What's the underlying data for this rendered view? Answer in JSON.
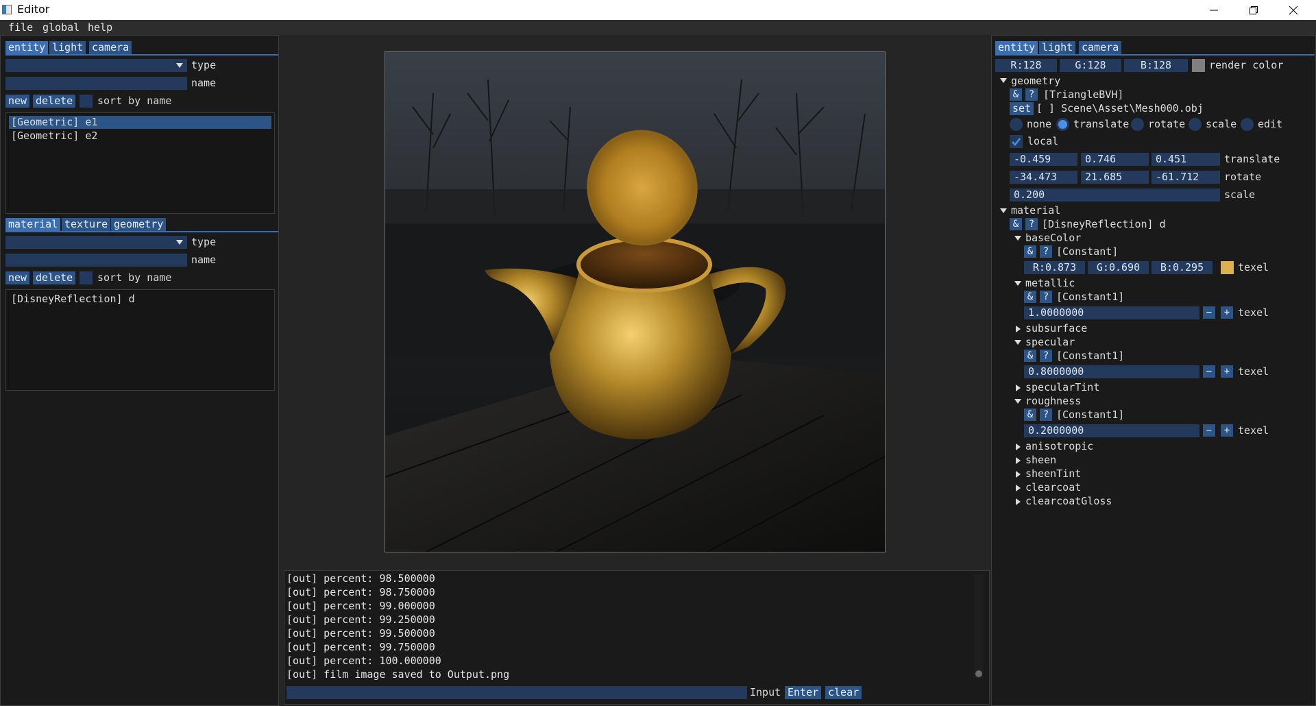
{
  "window": {
    "title": "Editor"
  },
  "menu": [
    "file",
    "global",
    "help"
  ],
  "left": {
    "tabs": [
      "entity",
      "light",
      "camera"
    ],
    "type_label": "type",
    "name_label": "name",
    "new_label": "new",
    "delete_label": "delete",
    "sort_label": "sort by name",
    "entities": [
      "[Geometric] e1",
      "[Geometric] e2"
    ],
    "sub_tabs": [
      "material",
      "texture",
      "geometry"
    ],
    "type_label2": "type",
    "name_label2": "name",
    "new_label2": "new",
    "delete_label2": "delete",
    "sort_label2": "sort by name",
    "materials": [
      "[DisneyReflection] d"
    ]
  },
  "console": {
    "lines": [
      "[out] percent: 98.500000",
      "[out] percent: 98.750000",
      "[out] percent: 99.000000",
      "[out] percent: 99.250000",
      "[out] percent: 99.500000",
      "[out] percent: 99.750000",
      "[out] percent: 100.000000",
      "[out] film image saved to Output.png"
    ],
    "input_label": "Input",
    "enter_label": "Enter",
    "clear_label": "clear"
  },
  "right": {
    "tabs": [
      "entity",
      "light",
      "camera"
    ],
    "render_color": {
      "r": "R:128",
      "g": "G:128",
      "b": "B:128",
      "label": "render color",
      "swatch": "#808080"
    },
    "geometry": {
      "header": "geometry",
      "amp": "&",
      "q": "?",
      "type": "[TriangleBVH]",
      "set_label": "set",
      "path": "[ ] Scene\\Asset\\Mesh000.obj",
      "modes": [
        "none",
        "translate",
        "rotate",
        "scale",
        "edit"
      ],
      "selected_mode": "translate",
      "local_label": "local",
      "translate": [
        "-0.459",
        "0.746",
        "0.451"
      ],
      "translate_label": "translate",
      "rotate": [
        "-34.473",
        "21.685",
        "-61.712"
      ],
      "rotate_label": "rotate",
      "scale": "0.200",
      "scale_label": "scale"
    },
    "material": {
      "header": "material",
      "amp": "&",
      "q": "?",
      "type": "[DisneyReflection] d",
      "baseColor": {
        "header": "baseColor",
        "type": "[Constant]",
        "r": "R:0.873",
        "g": "G:0.690",
        "b": "B:0.295",
        "swatch": "#dfb04b",
        "texel": "texel"
      },
      "metallic": {
        "header": "metallic",
        "type": "[Constant1]",
        "value": "1.0000000",
        "texel": "texel"
      },
      "subsurface": "subsurface",
      "specular": {
        "header": "specular",
        "type": "[Constant1]",
        "value": "0.8000000",
        "texel": "texel"
      },
      "specularTint": "specularTint",
      "roughness": {
        "header": "roughness",
        "type": "[Constant1]",
        "value": "0.2000000",
        "texel": "texel"
      },
      "collapsed": [
        "anisotropic",
        "sheen",
        "sheenTint",
        "clearcoat",
        "clearcoatGloss"
      ],
      "minus": "−",
      "plus": "+"
    }
  }
}
